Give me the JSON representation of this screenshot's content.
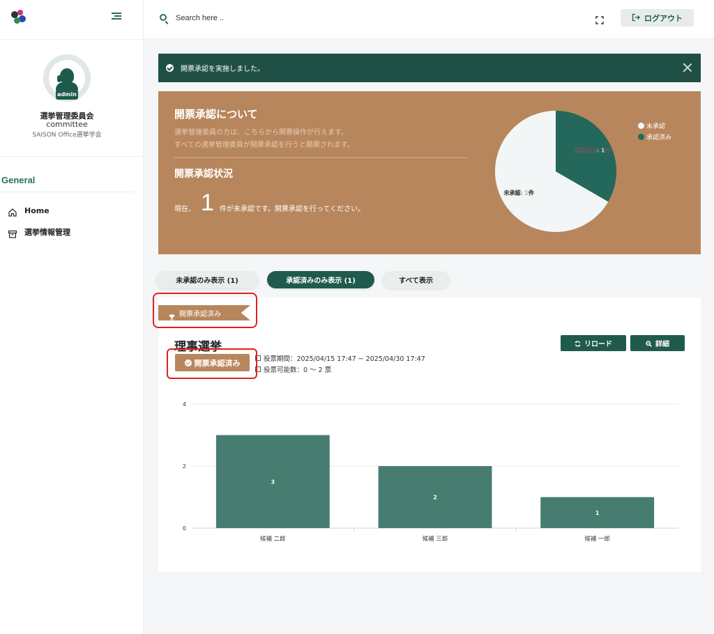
{
  "sidebar": {
    "user": {
      "badge": "admin",
      "name": "選挙管理委員会",
      "role": "committee",
      "org": "SAISON Office選挙学会"
    },
    "section_title": "General",
    "items": [
      {
        "label": "Home",
        "icon": "home-icon"
      },
      {
        "label": "選挙情報管理",
        "icon": "archive-icon"
      }
    ]
  },
  "header": {
    "search_placeholder": "Search here ..",
    "logout_label": "ログアウト"
  },
  "alert": {
    "message": "開票承認を実施しました。"
  },
  "panel": {
    "title": "開票承認について",
    "desc1": "選挙管理委員の方は、こちらから開票操作が行えます。",
    "desc2": "すべての選挙管理委員が開票承認を行うと開票されます。",
    "status_title": "開票承認状況",
    "status_prefix": "現在、",
    "status_count": "1",
    "status_suffix": "件が未承認です。開票承認を行ってください。",
    "pie": {
      "slices": [
        {
          "label": "未承認",
          "value": 2,
          "color": "#f3f6f7",
          "data_label": "未承認: 2件"
        },
        {
          "label": "承認済み",
          "value": 1,
          "color": "#23685a",
          "data_label": "承認済み: 1件"
        }
      ]
    }
  },
  "filters": [
    {
      "label": "未承認のみ表示 (1)",
      "active": false
    },
    {
      "label": "承認済みのみ表示 (1)",
      "active": true
    },
    {
      "label": "すべて表示",
      "active": false
    }
  ],
  "card": {
    "ribbon": "開票承認済み",
    "title": "理事選挙",
    "approved_label": "開票承認済み",
    "period": "投票期間：2025/04/15 17:47 ~ 2025/04/30 17:47",
    "votes": "投票可能数：0 〜 2 票",
    "reload_label": "リロード",
    "detail_label": "詳細"
  },
  "chart_data": {
    "type": "bar",
    "categories": [
      "候補 二郎",
      "候補 三郎",
      "候補 一郎"
    ],
    "values": [
      3,
      2,
      1
    ],
    "ylim": [
      0,
      4
    ],
    "yticks": [
      0,
      2,
      4
    ],
    "bar_color": "#467d70",
    "grid": true
  }
}
